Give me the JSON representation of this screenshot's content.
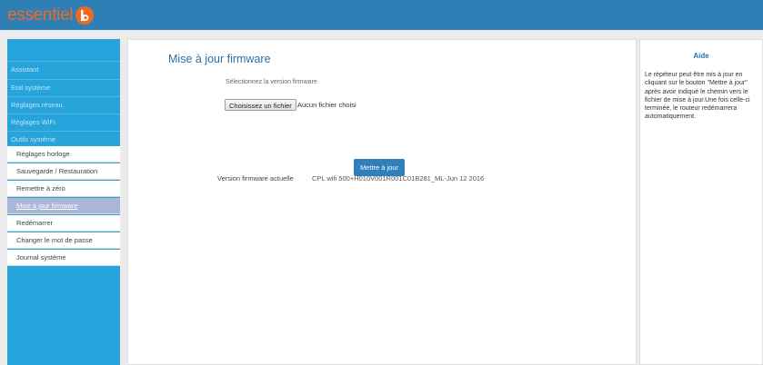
{
  "header": {
    "logo_text": "essentiel",
    "brand_color": "#ef6b22",
    "bar_color": "#2d7fb6"
  },
  "sidebar": {
    "items": [
      {
        "label": "Assistant"
      },
      {
        "label": "Etat système"
      },
      {
        "label": "Réglages réseau"
      },
      {
        "label": "Réglages WiFi"
      },
      {
        "label": "Outils système"
      }
    ],
    "sub_items": [
      {
        "label": "Réglages horloge"
      },
      {
        "label": "Sauvegarde / Restauration"
      },
      {
        "label": "Remettre à zéro"
      },
      {
        "label": "Mise à jour firmware",
        "active": true
      },
      {
        "label": "Redémarrer"
      },
      {
        "label": "Changer le mot de passe"
      },
      {
        "label": "Journal système"
      }
    ],
    "color": "#27a4db"
  },
  "main": {
    "title": "Mise à jour firmware",
    "select_label": "Sélectionnez la version firmware",
    "file_button": "Choisissez un fichier",
    "file_status": "Aucun fichier choisi",
    "update_button": "Mettre à jour",
    "firmware_label": "Version firmware actuelle",
    "firmware_value": "CPL wifi 500+H010V001R001C01B281_ML-Jun 12 2016"
  },
  "help": {
    "title": "Aide",
    "text": "Le répéteur peut être mis à jour en cliquant sur le bouton \"Mettre à jour\" après avoir indiqué le chemin vers le fichier de mise à jour.Une fois celle-ci terminée, le routeur redémarrera automatiquement."
  }
}
